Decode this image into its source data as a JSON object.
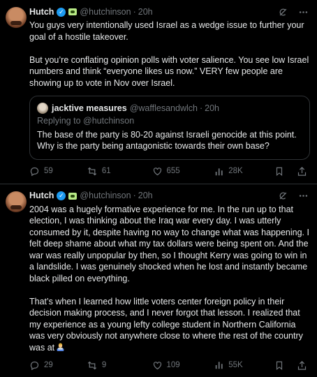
{
  "tweets": [
    {
      "name": "Hutch",
      "handle": "@hutchinson",
      "dot": "·",
      "time": "20h",
      "text": "You guys very intentionally used Israel as a wedge issue to further your goal of a hostile takeover.\n\nBut you’re conflating opinion polls with voter salience. You see low Israel numbers and think “everyone likes us now.” VERY few people are showing up to vote in Nov over Israel.",
      "quote": {
        "name": "jacktive measures",
        "handle": "@wafflesandwlch",
        "dot": "·",
        "time": "20h",
        "reply": "Replying to @hutchinson",
        "text": "The base of the party is 80-20 against Israeli genocide at this point. Why is the party being antagonistic towards their own base?"
      },
      "replies": "59",
      "reposts": "61",
      "likes": "655",
      "views": "28K"
    },
    {
      "name": "Hutch",
      "handle": "@hutchinson",
      "dot": "·",
      "time": "20h",
      "text": "2004 was a hugely formative experience for me. In the run up to that election, I was thinking about the Iraq war every day. I was utterly consumed by it, despite having no way to change what was happening. I felt deep shame about what my tax dollars were being spent on. And the war was really unpopular by then, so I thought Kerry was going to win in a landslide. I was genuinely shocked when he lost and instantly became black pilled on everything.\n\nThat’s when I learned how little voters center foreign policy in their decision making process, and I never forgot that lesson. I realized that my experience as a young lefty college student in Northern California was very obviously not anywhere close to where the rest of the country was at",
      "replies": "29",
      "reposts": "9",
      "likes": "109",
      "views": "55K"
    }
  ],
  "icons": {
    "verified": "verified-badge-icon",
    "affiliate": "affiliate-badge-icon",
    "grok": "grok-icon",
    "more": "more-icon",
    "reply": "reply-icon",
    "repost": "repost-icon",
    "like": "heart-icon",
    "views": "views-icon",
    "bookmark": "bookmark-icon",
    "share": "share-icon",
    "emoji": "man-technologist-emoji"
  },
  "colors": {
    "background": "#000000",
    "text": "#e7e9ea",
    "muted": "#71767b",
    "verified": "#1d9bf0",
    "border": "#2f3336"
  }
}
